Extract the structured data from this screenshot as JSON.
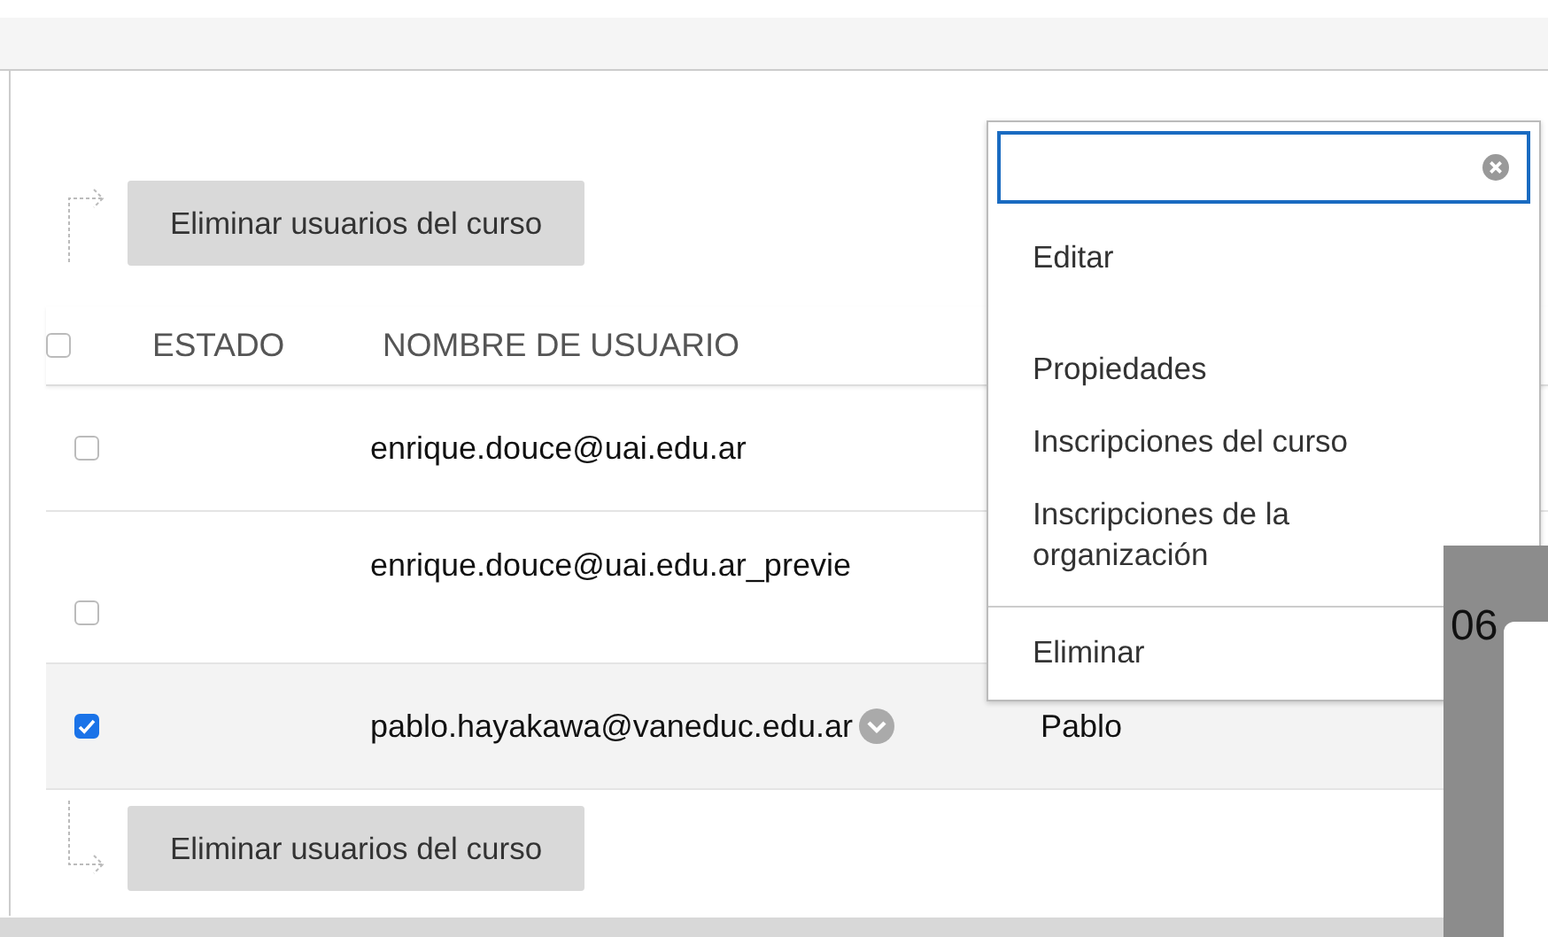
{
  "toolbar_top": {
    "button": "Eliminar usuarios del curso"
  },
  "table": {
    "select_all": {
      "checked": false
    },
    "columns": [
      "ESTADO",
      "NOMBRE DE USUARIO"
    ],
    "rows": [
      {
        "checked": false,
        "username": "enrique.douce@uai.edu.ar",
        "menu_button": false
      },
      {
        "checked": false,
        "username": "enrique.douce@uai.edu.ar_previe",
        "menu_button": false
      },
      {
        "checked": true,
        "username": "pablo.hayakawa@vaneduc.edu.ar",
        "menu_button": true,
        "column_3": "Pablo"
      }
    ]
  },
  "toolbar_bottom": {
    "button": "Eliminar usuarios del curso"
  },
  "context_menu": {
    "items": [
      {
        "label": "Editar",
        "divider_before": false
      },
      {
        "label": "Propiedades",
        "divider_before": false
      },
      {
        "label": "Inscripciones del curso",
        "divider_before": false
      },
      {
        "label": "Inscripciones de la organización",
        "divider_before": false
      },
      {
        "label": "Eliminar",
        "divider_before": true
      }
    ]
  },
  "side_panel": {
    "text": "06"
  }
}
